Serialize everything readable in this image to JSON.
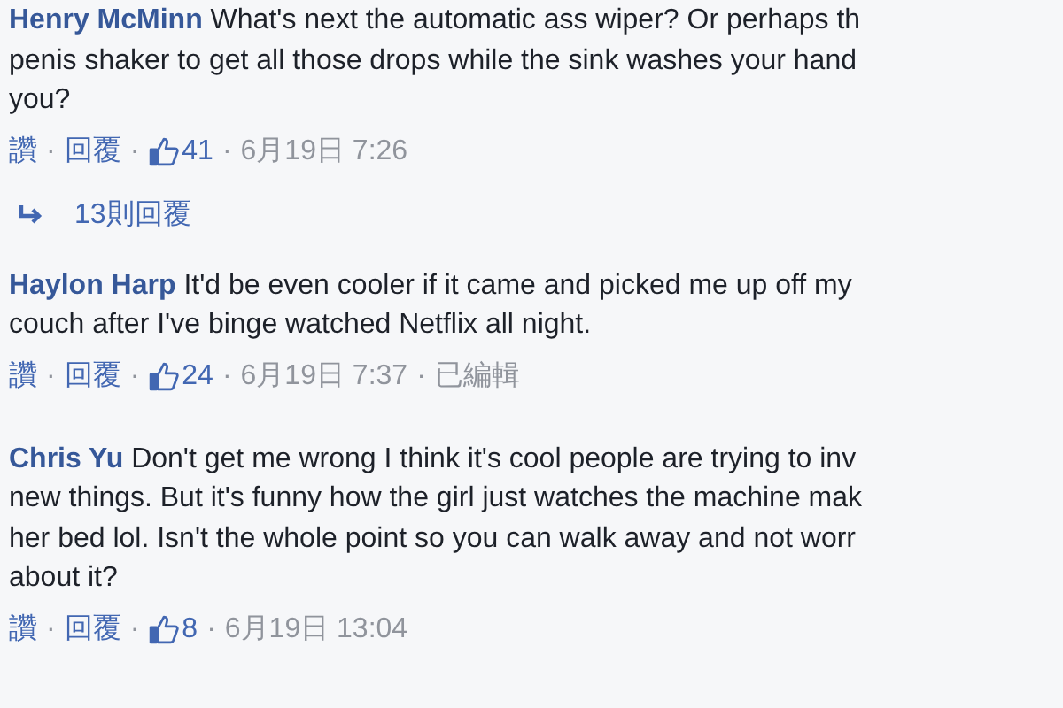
{
  "comments": [
    {
      "author": "Henry McMinn",
      "lines": [
        "What's next the automatic ass wiper? Or perhaps th",
        "penis shaker to get all those drops while the sink washes your hand",
        "you?"
      ],
      "meta": [
        {
          "kind": "link",
          "text": "讚"
        },
        {
          "kind": "sep",
          "text": "·"
        },
        {
          "kind": "link",
          "text": "回覆"
        },
        {
          "kind": "sep",
          "text": "·"
        },
        {
          "kind": "likes",
          "text": "41"
        },
        {
          "kind": "sep",
          "text": "·"
        },
        {
          "kind": "time",
          "text": "6月19日 7:26"
        }
      ],
      "replies": "13則回覆"
    },
    {
      "author": "Haylon Harp",
      "lines": [
        "It'd be even cooler if it came and picked me up off my",
        "couch after I've binge watched Netflix all night."
      ],
      "meta": [
        {
          "kind": "link",
          "text": "讚"
        },
        {
          "kind": "sep",
          "text": "·"
        },
        {
          "kind": "link",
          "text": "回覆"
        },
        {
          "kind": "sep",
          "text": "·"
        },
        {
          "kind": "likes",
          "text": "24"
        },
        {
          "kind": "sep",
          "text": "·"
        },
        {
          "kind": "time",
          "text": "6月19日 7:37"
        },
        {
          "kind": "sep",
          "text": "·"
        },
        {
          "kind": "time",
          "text": "已編輯"
        }
      ]
    },
    {
      "author": "Chris Yu",
      "lines": [
        "Don't get me wrong I think it's cool people are trying to inv",
        "new things. But it's funny how the girl just watches the machine mak",
        "her bed lol. Isn't the whole point so you can walk away and not worr",
        "about it?"
      ],
      "meta": [
        {
          "kind": "link",
          "text": "讚"
        },
        {
          "kind": "sep",
          "text": "·"
        },
        {
          "kind": "link",
          "text": "回覆"
        },
        {
          "kind": "sep",
          "text": "·"
        },
        {
          "kind": "likes",
          "text": "8"
        },
        {
          "kind": "sep",
          "text": "·"
        },
        {
          "kind": "time",
          "text": "6月19日 13:04"
        }
      ]
    }
  ]
}
